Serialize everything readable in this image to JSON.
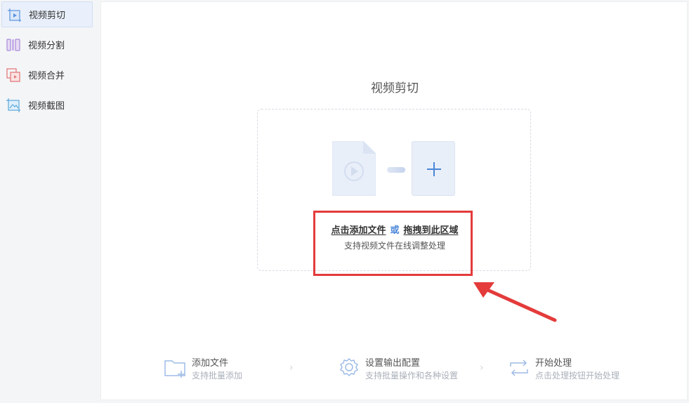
{
  "sidebar": {
    "items": [
      {
        "label": "视频剪切",
        "icon": "video-cut-icon",
        "active": true
      },
      {
        "label": "视频分割",
        "icon": "video-split-icon",
        "active": false
      },
      {
        "label": "视频合并",
        "icon": "video-merge-icon",
        "active": false
      },
      {
        "label": "视频截图",
        "icon": "video-screenshot-icon",
        "active": false
      }
    ]
  },
  "main": {
    "title": "视频剪切",
    "dropzone": {
      "click_add": "点击添加文件",
      "or": "或",
      "drag_here": "拖拽到此区域",
      "subtitle": "支持视频文件在线调整处理"
    },
    "steps": [
      {
        "title": "添加文件",
        "desc": "支持批量添加",
        "icon": "add-folder-icon"
      },
      {
        "title": "设置输出配置",
        "desc": "支持批量操作和各种设置",
        "icon": "gear-icon"
      },
      {
        "title": "开始处理",
        "desc": "点击处理按钮开始处理",
        "icon": "process-cycle-icon"
      }
    ],
    "step_separator": "›"
  },
  "colors": {
    "accent": "#4a86d8",
    "highlight": "#e43b3b",
    "active_bg": "#e9f0fb"
  }
}
